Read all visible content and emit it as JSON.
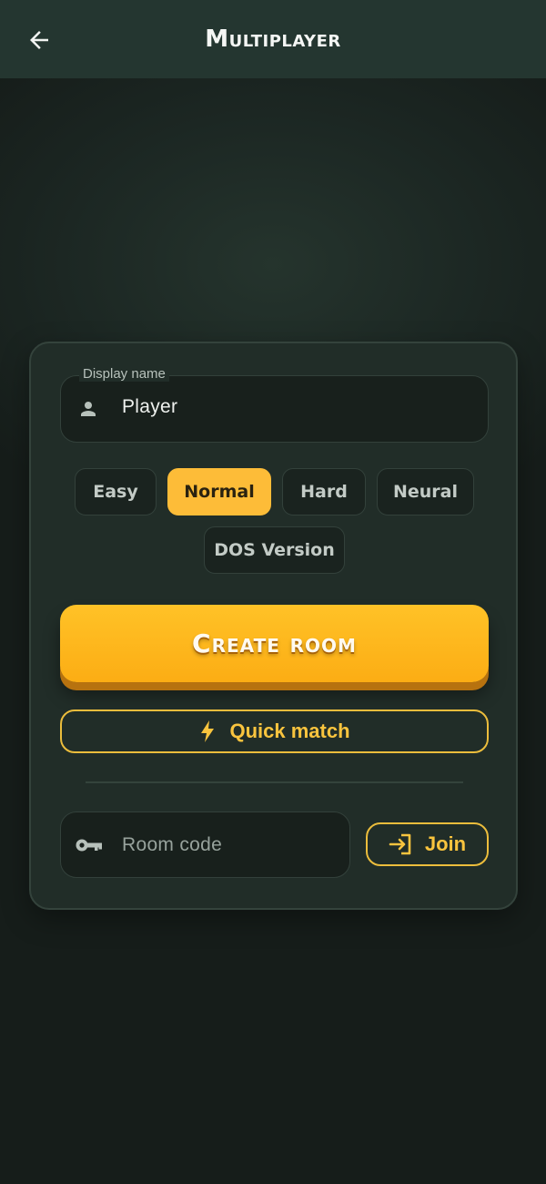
{
  "header": {
    "title": "Multiplayer",
    "back_icon": "arrow-left-icon"
  },
  "name_field": {
    "label": "Display name",
    "value": "Player",
    "icon": "person-icon"
  },
  "difficulty": {
    "options": [
      "Easy",
      "Normal",
      "Hard",
      "Neural",
      "DOS Version"
    ],
    "selected": "Normal"
  },
  "actions": {
    "create_room_label": "Create room",
    "quick_match_label": "Quick match",
    "quick_match_icon": "lightning-bolt-icon"
  },
  "join": {
    "placeholder": "Room code",
    "code_icon": "key-icon",
    "join_label": "Join",
    "join_icon": "login-arrow-icon"
  },
  "colors": {
    "accent": "#fdbc38",
    "accent_text": "#f9c43e",
    "background": "#1c2723",
    "card": "#212d28"
  }
}
